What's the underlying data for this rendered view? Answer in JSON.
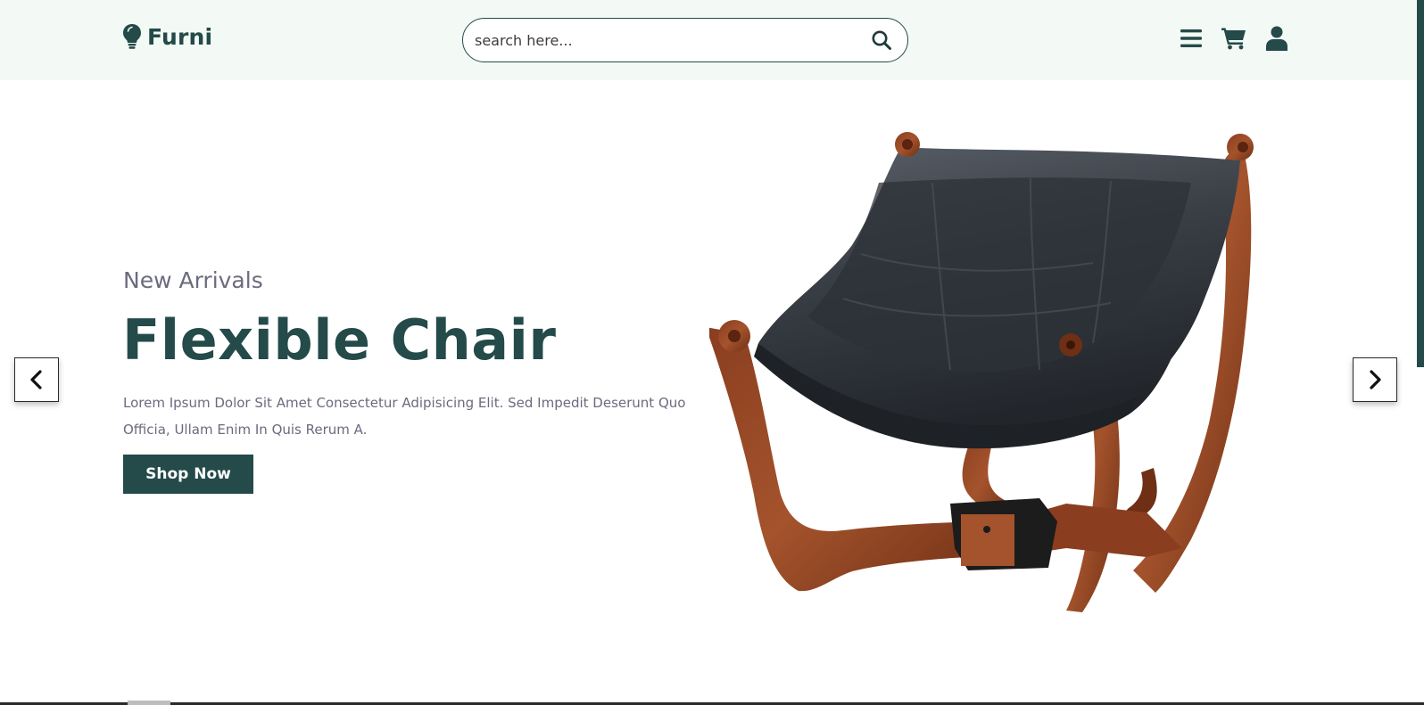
{
  "brand": {
    "name": "Furni",
    "logo_icon": "lightbulb-icon"
  },
  "search": {
    "placeholder": "search here...",
    "icon": "search-icon"
  },
  "header_icons": [
    "menu-icon",
    "cart-icon",
    "user-icon"
  ],
  "hero": {
    "subtitle": "New Arrivals",
    "title": "Flexible Chair",
    "description": "Lorem Ipsum Dolor Sit Amet Consectetur Adipisicing Elit. Sed Impedit Deserunt Quo Officia, Ullam Enim In Quis Rerum A.",
    "cta_label": "Shop Now",
    "image": "leather-chair-image"
  },
  "slider": {
    "prev_icon": "chevron-left-icon",
    "next_icon": "chevron-right-icon"
  },
  "colors": {
    "primary": "#244a4a",
    "header_bg": "#f3f9f4",
    "muted_text": "#6b6b7f",
    "background": "#ffffff"
  }
}
